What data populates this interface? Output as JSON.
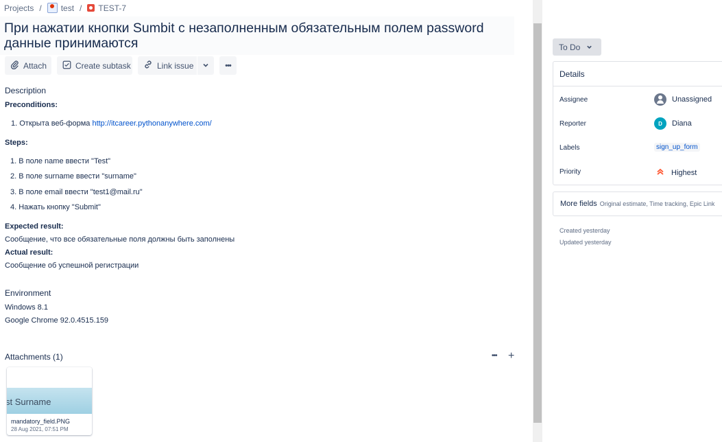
{
  "breadcrumb": {
    "projects": "Projects",
    "project": "test",
    "issue_key": "TEST-7",
    "separator": "/"
  },
  "issue": {
    "title": "При нажатии кнопки Sumbit с незаполненным обязательным полем password данные принимаются"
  },
  "toolbar": {
    "attach": "Attach",
    "create_subtask": "Create subtask",
    "link_issue": "Link issue",
    "chevron": "⌄",
    "more": "•••"
  },
  "description": {
    "heading": "Description",
    "preconditions_label": "Preconditions:",
    "preconditions": {
      "item1_prefix": "1.  Открыта веб-форма ",
      "item1_link": "http://itcareer.pythonanywhere.com/"
    },
    "steps_label": "Steps:",
    "steps": [
      "1. В поле name ввести \"Test\"",
      "2. В поле surname ввести \"surname\"",
      "3. В поле email ввести \"test1@mail.ru\"",
      "4. Нажать кнопку \"Submit\""
    ],
    "expected_label": "Expected result:",
    "expected": "Сообщение, что все обязательные поля должны быть заполнены",
    "actual_label": "Actual result:",
    "actual": "Сообщение об успешной регистрации"
  },
  "environment": {
    "heading": "Environment",
    "lines": [
      "Windows 8.1",
      "Google Chrome 92.0.4515.159"
    ]
  },
  "attachments": {
    "heading": "Attachments (1)",
    "more": "•••",
    "add": "+",
    "file": {
      "preview_text": "st Surname",
      "name": "mandatory_field.PNG",
      "date": "28 Aug 2021, 07:51 PM"
    }
  },
  "status": {
    "label": "To Do",
    "chevron": "⌄"
  },
  "details": {
    "heading": "Details",
    "fields": {
      "assignee_label": "Assignee",
      "assignee": "Unassigned",
      "reporter_label": "Reporter",
      "reporter": "Diana",
      "reporter_initial": "D",
      "labels_label": "Labels",
      "label_value": "sign_up_form",
      "priority_label": "Priority",
      "priority": "Highest",
      "priority_icon": "︽"
    }
  },
  "more_fields": {
    "label": "More fields",
    "hint": "Original estimate, Time tracking, Epic Link"
  },
  "meta": {
    "created": "Created yesterday",
    "updated": "Updated yesterday"
  },
  "colors": {
    "link": "#0052cc",
    "text": "#172b4d",
    "muted": "#5e6c84",
    "priority_highest": "#ff5630",
    "reporter_avatar": "#00a3bf"
  }
}
